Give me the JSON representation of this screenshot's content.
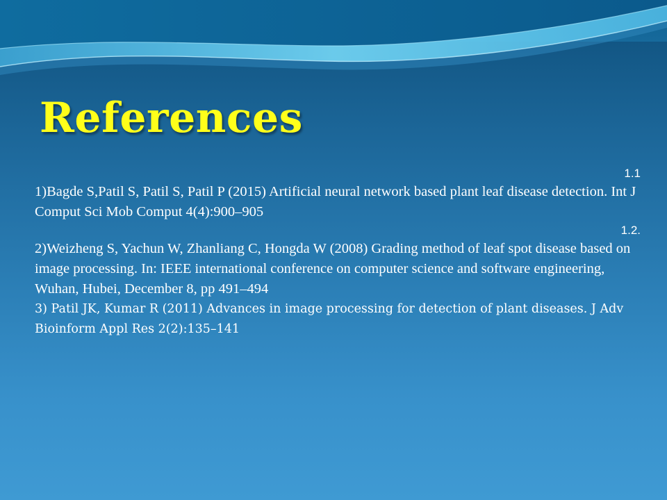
{
  "slide": {
    "title": "References",
    "colors": {
      "title": "#ffff1a",
      "text": "#ffffff",
      "background_top": "#0e4f7b",
      "background_bottom": "#3f9ad3",
      "wave": "#5fc6ea"
    },
    "references": [
      {
        "label": "1.1",
        "text": "1)Bagde  S,Patil  S, Patil S, Patil P (2015) Artificial neural network based plant leaf disease detection. Int J Comput Sci Mob Comput 4(4):900–905"
      },
      {
        "label": "1.2.",
        "text": "2)Weizheng S, Yachun W, Zhanliang C, Hongda W (2008) Grading method of leaf spot disease based on image processing. In: IEEE international conference on computer science and software engineering, Wuhan, Hubei, December 8, pp 491–494"
      },
      {
        "label": "",
        "text": "3) Patil JK, Kumar R (2011) Advances in image processing for detection of plant diseases. J Adv Bioinform Appl Res 2(2):135–141"
      }
    ]
  }
}
